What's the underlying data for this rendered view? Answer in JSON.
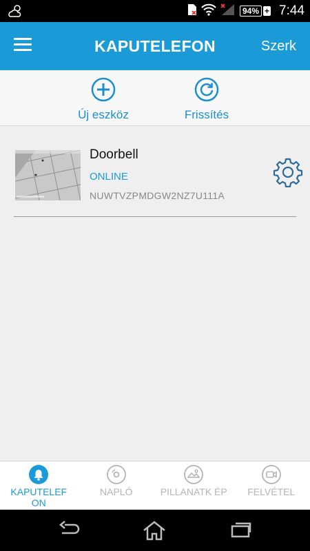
{
  "status_bar": {
    "battery_percent": "94%",
    "charging_symbol": "+",
    "time": "7:44",
    "icons": [
      "weather-cloud-icon",
      "sim-icon",
      "wifi-icon",
      "signal-icon",
      "battery-icon"
    ]
  },
  "app_bar": {
    "title": "KAPUTELEFON",
    "edit_label": "Szerk",
    "color": "#1a9ad6"
  },
  "actions": {
    "new_device_label": "Új eszköz",
    "refresh_label": "Frissítés"
  },
  "devices": [
    {
      "name": "Doorbell",
      "status": "ONLINE",
      "id": "NUWTVZPMDGW2NZ7U111A"
    }
  ],
  "tabs": [
    {
      "label": "KAPUTELEF ON",
      "icon": "bell-icon",
      "active": true
    },
    {
      "label": "NAPLÓ",
      "icon": "disc-icon",
      "active": false
    },
    {
      "label": "PILLANATK ÉP",
      "icon": "image-icon",
      "active": false
    },
    {
      "label": "FELVÉTEL",
      "icon": "video-icon",
      "active": false
    }
  ],
  "colors": {
    "accent": "#1a9ad6",
    "inactive_tab": "#b4b4b4"
  }
}
